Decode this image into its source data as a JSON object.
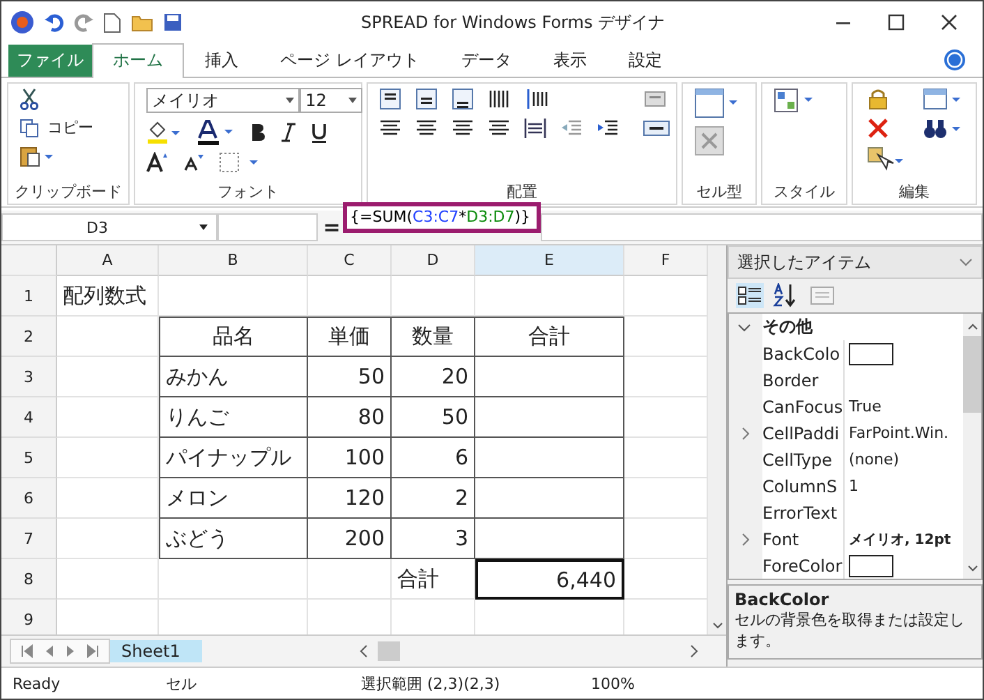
{
  "window": {
    "title": "SPREAD for Windows Forms デザイナ"
  },
  "tabs": [
    {
      "label": "ファイル",
      "kind": "file",
      "selected": false
    },
    {
      "label": "ホーム",
      "kind": "tab",
      "selected": true
    },
    {
      "label": "挿入",
      "kind": "tab",
      "selected": false
    },
    {
      "label": "ページ レイアウト",
      "kind": "tab",
      "selected": false
    },
    {
      "label": "データ",
      "kind": "tab",
      "selected": false
    },
    {
      "label": "表示",
      "kind": "tab",
      "selected": false
    },
    {
      "label": "設定",
      "kind": "tab",
      "selected": false
    }
  ],
  "ribbon": {
    "clipboard": {
      "label": "クリップボード",
      "copy": "コピー"
    },
    "font": {
      "label": "フォント",
      "family": "メイリオ",
      "size": "12"
    },
    "alignment": {
      "label": "配置"
    },
    "cell_type": {
      "label": "セル型"
    },
    "style": {
      "label": "スタイル"
    },
    "edit": {
      "label": "編集"
    }
  },
  "formula_bar": {
    "name_box": "D3",
    "equals": "=",
    "formula": [
      {
        "text": "{=SUM(",
        "color": "#000000"
      },
      {
        "text": "C3:C7",
        "color": "#1f3fff"
      },
      {
        "text": "*",
        "color": "#000000"
      },
      {
        "text": "D3:D7",
        "color": "#0a8a0a"
      },
      {
        "text": ")}",
        "color": "#000000"
      }
    ]
  },
  "columns": [
    {
      "label": "A",
      "selected": false
    },
    {
      "label": "B",
      "selected": false
    },
    {
      "label": "C",
      "selected": false
    },
    {
      "label": "D",
      "selected": false
    },
    {
      "label": "E",
      "selected": true
    },
    {
      "label": "F",
      "selected": false
    }
  ],
  "rows": [
    {
      "label": "1",
      "cells": {
        "a": {
          "text": "配列数式",
          "kind": "text"
        }
      }
    },
    {
      "label": "2",
      "cells": {
        "b": {
          "text": "品名",
          "kind": "header"
        },
        "c": {
          "text": "単価",
          "kind": "header"
        },
        "d": {
          "text": "数量",
          "kind": "header"
        },
        "e": {
          "text": "合計",
          "kind": "header"
        }
      }
    },
    {
      "label": "3",
      "cells": {
        "b": {
          "text": "みかん",
          "kind": "text"
        },
        "c": {
          "text": "50",
          "kind": "number"
        },
        "d": {
          "text": "20",
          "kind": "number"
        }
      }
    },
    {
      "label": "4",
      "cells": {
        "b": {
          "text": "りんご",
          "kind": "text"
        },
        "c": {
          "text": "80",
          "kind": "number"
        },
        "d": {
          "text": "50",
          "kind": "number"
        }
      }
    },
    {
      "label": "5",
      "cells": {
        "b": {
          "text": "パイナップル",
          "kind": "text"
        },
        "c": {
          "text": "100",
          "kind": "number"
        },
        "d": {
          "text": "6",
          "kind": "number"
        }
      }
    },
    {
      "label": "6",
      "cells": {
        "b": {
          "text": "メロン",
          "kind": "text"
        },
        "c": {
          "text": "120",
          "kind": "number"
        },
        "d": {
          "text": "2",
          "kind": "number"
        }
      }
    },
    {
      "label": "7",
      "cells": {
        "b": {
          "text": "ぶどう",
          "kind": "text"
        },
        "c": {
          "text": "200",
          "kind": "number"
        },
        "d": {
          "text": "3",
          "kind": "number"
        }
      }
    },
    {
      "label": "8",
      "cells": {
        "d": {
          "text": "合計",
          "kind": "text"
        },
        "e": {
          "text": "6,440",
          "kind": "total"
        }
      }
    },
    {
      "label": "9",
      "cells": {}
    }
  ],
  "sheet_tabs": [
    {
      "label": "Sheet1",
      "selected": true
    }
  ],
  "properties": {
    "object": "選択したアイテム",
    "category": "その他",
    "items": [
      {
        "name": "BackColo",
        "kind": "swatch",
        "expandable": false
      },
      {
        "name": "Border",
        "kind": "text",
        "value": "",
        "expandable": false
      },
      {
        "name": "CanFocus",
        "kind": "text",
        "value": "True",
        "expandable": false
      },
      {
        "name": "CellPaddi",
        "kind": "text",
        "value": "FarPoint.Win.",
        "expandable": true
      },
      {
        "name": "CellType",
        "kind": "text",
        "value": "(none)",
        "expandable": false
      },
      {
        "name": "ColumnS",
        "kind": "text",
        "value": "1",
        "expandable": false
      },
      {
        "name": "ErrorText",
        "kind": "text",
        "value": "",
        "expandable": false
      },
      {
        "name": "Font",
        "kind": "bold",
        "value": "メイリオ, 12pt",
        "expandable": true
      },
      {
        "name": "ForeColor",
        "kind": "swatch",
        "expandable": false
      }
    ],
    "help_title": "BackColor",
    "help_text": "セルの背景色を取得または設定します。"
  },
  "status_bar": {
    "state": "Ready",
    "mode": "セル",
    "range": "選択範囲 (2,3)(2,3)",
    "zoom": "100%"
  }
}
